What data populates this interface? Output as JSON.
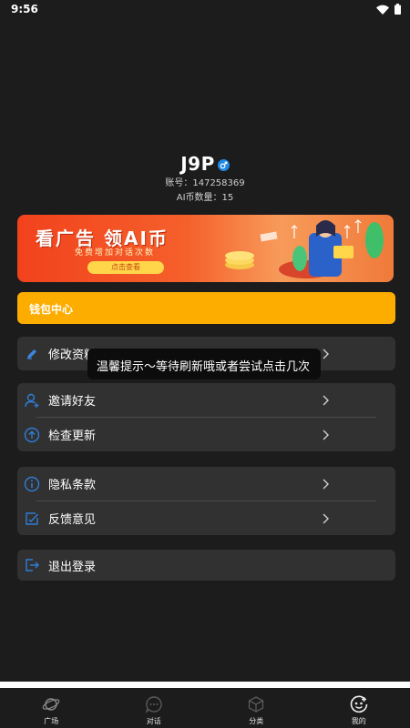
{
  "status_bar": {
    "time": "9:56"
  },
  "profile": {
    "username": "J9P",
    "account_line": "账号：147258369",
    "coins_line": "AI币数量：15"
  },
  "banner": {
    "title": "看广告  领AI币",
    "subtitle": "免费增加对话次数",
    "button": "点击查看"
  },
  "wallet": {
    "label": "钱包中心"
  },
  "menu": {
    "edit_profile": "修改资料",
    "invite_friends": "邀请好友",
    "check_update": "检查更新",
    "privacy": "隐私条款",
    "feedback": "反馈意见",
    "logout": "退出登录"
  },
  "toast": {
    "text": "温馨提示～等待刷新哦或者尝试点击几次"
  },
  "tabbar": {
    "tabs": [
      {
        "label": "广场",
        "icon": "planet-icon"
      },
      {
        "label": "对话",
        "icon": "chat-bubble-icon"
      },
      {
        "label": "分类",
        "icon": "cube-icon"
      },
      {
        "label": "我的",
        "icon": "smile-face-icon"
      }
    ]
  },
  "colors": {
    "background": "#1c1c1c",
    "card": "#313131",
    "wallet_accent": "#fdad00",
    "icon_blue": "#2f7dd6",
    "banner_red": "#f2421d"
  }
}
